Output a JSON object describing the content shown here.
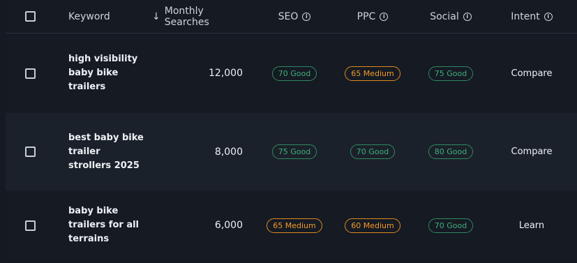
{
  "header": {
    "keyword": "Keyword",
    "monthly_searches": "Monthly Searches",
    "seo": "SEO",
    "ppc": "PPC",
    "social": "Social",
    "intent": "Intent"
  },
  "colors": {
    "good": "#3fb07a",
    "medium": "#f39a2a"
  },
  "rows": [
    {
      "keyword": "high visibility baby bike trailers",
      "monthly_searches": "12,000",
      "seo": "70 Good",
      "seo_level": "good",
      "ppc": "65 Medium",
      "ppc_level": "medium",
      "social": "75 Good",
      "social_level": "good",
      "intent": "Compare"
    },
    {
      "keyword": "best baby bike trailer strollers 2025",
      "monthly_searches": "8,000",
      "seo": "75 Good",
      "seo_level": "good",
      "ppc": "70 Good",
      "ppc_level": "good",
      "social": "80 Good",
      "social_level": "good",
      "intent": "Compare"
    },
    {
      "keyword": "baby bike trailers for all terrains",
      "monthly_searches": "6,000",
      "seo": "65 Medium",
      "seo_level": "medium",
      "ppc": "60 Medium",
      "ppc_level": "medium",
      "social": "70 Good",
      "social_level": "good",
      "intent": "Learn"
    }
  ]
}
